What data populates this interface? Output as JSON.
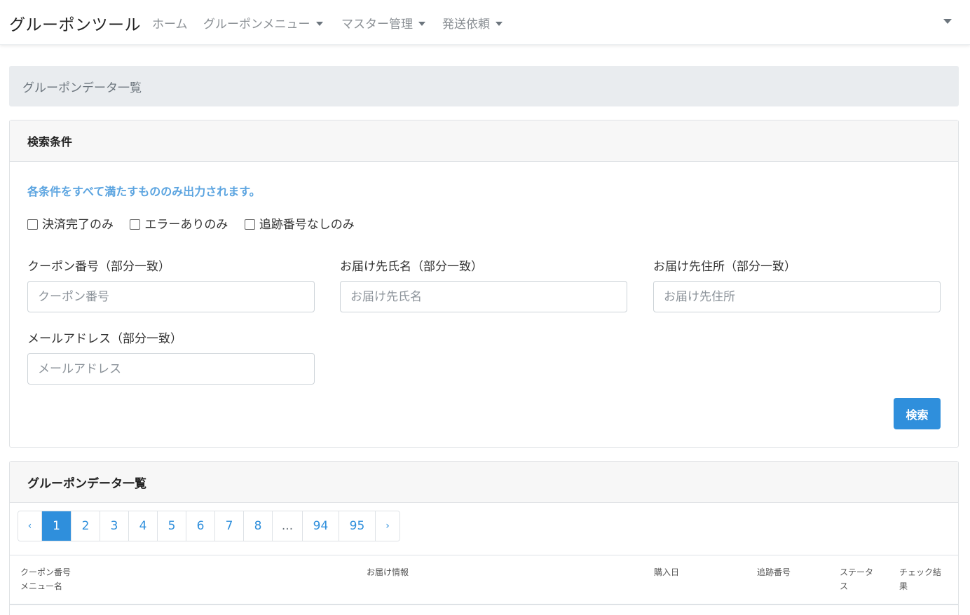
{
  "navbar": {
    "brand": "グルーポンツール",
    "items": [
      {
        "label": "ホーム"
      },
      {
        "label": "グルーポンメニュー"
      },
      {
        "label": "マスター管理"
      },
      {
        "label": "発送依頼"
      }
    ]
  },
  "breadcrumb": {
    "current": "グルーポンデータ一覧"
  },
  "search": {
    "header": "検索条件",
    "note": "各条件をすべて満たすもののみ出力されます。",
    "checkboxes": [
      {
        "label": "決済完了のみ",
        "checked": false
      },
      {
        "label": "エラーありのみ",
        "checked": false
      },
      {
        "label": "追跡番号なしのみ",
        "checked": false
      }
    ],
    "fields": {
      "coupon": {
        "label": "クーポン番号（部分一致）",
        "placeholder": "クーポン番号",
        "value": ""
      },
      "name": {
        "label": "お届け先氏名（部分一致）",
        "placeholder": "お届け先氏名",
        "value": ""
      },
      "address": {
        "label": "お届け先住所（部分一致）",
        "placeholder": "お届け先住所",
        "value": ""
      },
      "email": {
        "label": "メールアドレス（部分一致）",
        "placeholder": "メールアドレス",
        "value": ""
      }
    },
    "button": "検索"
  },
  "list": {
    "header": "グルーポンデータ一覧",
    "pagination": {
      "prev": "‹",
      "pages": [
        "1",
        "2",
        "3",
        "4",
        "5",
        "6",
        "7",
        "8",
        "...",
        "94",
        "95"
      ],
      "current": "1",
      "next": "›"
    },
    "columns": {
      "coupon": "クーポン番号",
      "menu": "メニュー名",
      "delivery": "お届け情報",
      "purchase_date": "購入日",
      "tracking": "追跡番号",
      "status_1": "ステータ",
      "status_2": "ス",
      "check_1": "チェック結",
      "check_2": "果"
    }
  },
  "colors": {
    "primary": "#2f8fdc",
    "note": "#5ba4e0",
    "breadcrumb_bg": "#e9ecef",
    "card_header_bg": "#f7f7f7"
  }
}
